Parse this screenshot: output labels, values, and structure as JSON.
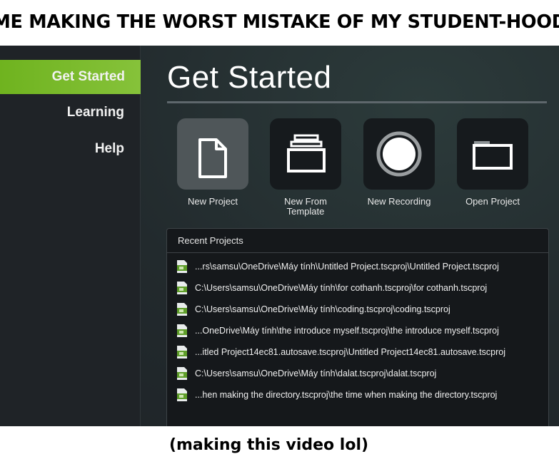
{
  "meme": {
    "top_caption": "ME MAKING THE WORST MISTAKE OF MY STUDENT-HOOD",
    "bottom_caption": "(making this video lol)"
  },
  "sidebar": {
    "items": [
      {
        "label": "Get Started",
        "active": true
      },
      {
        "label": "Learning",
        "active": false
      },
      {
        "label": "Help",
        "active": false
      }
    ]
  },
  "main": {
    "title": "Get Started",
    "actions": [
      {
        "label": "New Project",
        "icon": "document-icon"
      },
      {
        "label": "New From Template",
        "icon": "template-icon"
      },
      {
        "label": "New Recording",
        "icon": "record-icon"
      },
      {
        "label": "Open Project",
        "icon": "folder-icon"
      }
    ]
  },
  "recent": {
    "header": "Recent Projects",
    "items": [
      "...rs\\samsu\\OneDrive\\Máy tính\\Untitled Project.tscproj\\Untitled Project.tscproj",
      "C:\\Users\\samsu\\OneDrive\\Máy tính\\for cothanh.tscproj\\for cothanh.tscproj",
      "C:\\Users\\samsu\\OneDrive\\Máy tính\\coding.tscproj\\coding.tscproj",
      "...OneDrive\\Máy tính\\the introduce myself.tscproj\\the introduce myself.tscproj",
      "...itled Project14ec81.autosave.tscproj\\Untitled Project14ec81.autosave.tscproj",
      "C:\\Users\\samsu\\OneDrive\\Máy tính\\dalat.tscproj\\dalat.tscproj",
      "...hen making the directory.tscproj\\the time when making the directory.tscproj"
    ]
  },
  "colors": {
    "accent_green": "#7aba2c",
    "file_icon_green": "#5f9e2a",
    "panel_bg": "#15181b"
  }
}
